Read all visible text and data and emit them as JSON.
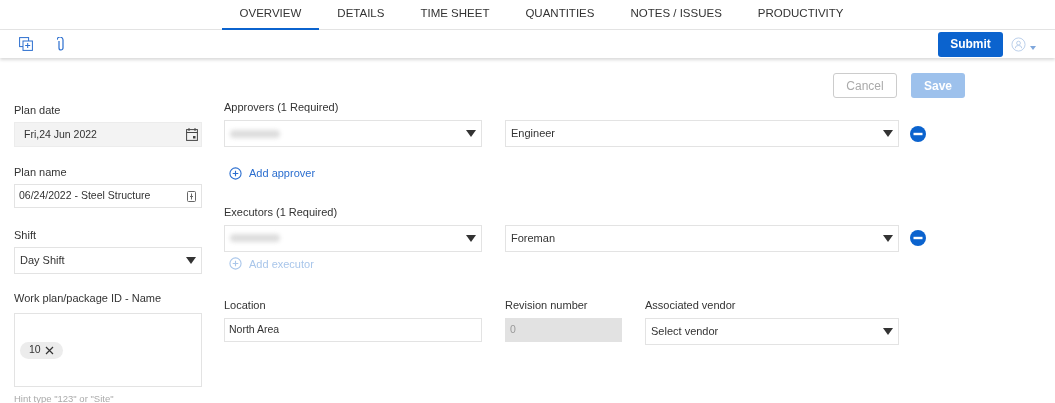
{
  "tabs": [
    {
      "label": "OVERVIEW",
      "selected": true
    },
    {
      "label": "DETAILS",
      "selected": false
    },
    {
      "label": "TIME SHEET",
      "selected": false
    },
    {
      "label": "QUANTITIES",
      "selected": false
    },
    {
      "label": "NOTES / ISSUES",
      "selected": false
    },
    {
      "label": "PRODUCTIVITY",
      "selected": false
    }
  ],
  "toolbar": {
    "submit": "Submit"
  },
  "actions": [
    {
      "label": "Cancel",
      "kind": "outline",
      "disabled": true
    },
    {
      "label": "Save",
      "kind": "primary",
      "disabled": true
    }
  ],
  "plan_date": {
    "label": "Plan date",
    "value": "Fri,24 Jun 2022"
  },
  "plan_name": {
    "label": "Plan name",
    "value": "06/24/2022 - Steel Structure"
  },
  "shift": {
    "label": "Shift",
    "value": "Day Shift"
  },
  "work_plan": {
    "label": "Work plan/package ID - Name",
    "chips": [
      "10"
    ],
    "hint": "Hint type \"123\" or \"Site\""
  },
  "groups": [
    {
      "label": "Approvers (1 Required)",
      "rows": [
        {
          "role": "Engineer"
        }
      ],
      "add": {
        "label": "Add approver",
        "disabled": false
      }
    },
    {
      "label": "Executors (1 Required)",
      "rows": [
        {
          "role": "Foreman"
        }
      ],
      "add": {
        "label": "Add executor",
        "disabled": true
      }
    }
  ],
  "location": {
    "label": "Location",
    "value": "North Area"
  },
  "revision": {
    "label": "Revision number",
    "value": "0",
    "disabled": true
  },
  "vendor": {
    "label": "Associated vendor",
    "placeholder": "Select vendor"
  }
}
